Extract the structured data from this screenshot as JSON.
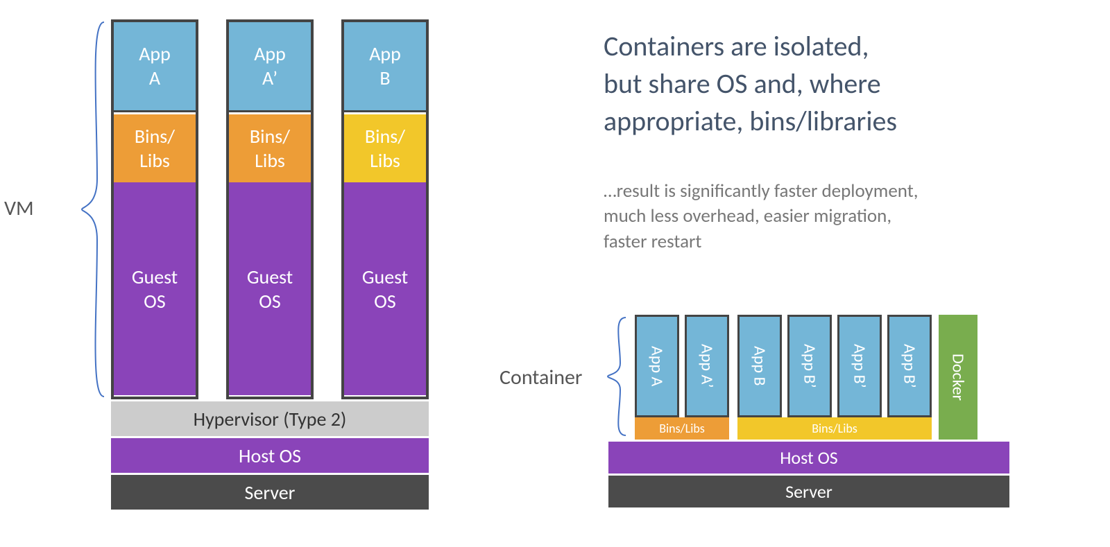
{
  "vm": {
    "label": "VM",
    "columns": [
      {
        "app": "App\nA",
        "lib": "Bins/\nLibs",
        "libColor": "orange",
        "os": "Guest\nOS"
      },
      {
        "app": "App\nA’",
        "lib": "Bins/\nLibs",
        "libColor": "orange",
        "os": "Guest\nOS"
      },
      {
        "app": "App\nB",
        "lib": "Bins/\nLibs",
        "libColor": "yellow",
        "os": "Guest\nOS"
      }
    ],
    "hypervisor": "Hypervisor (Type 2)",
    "host": "Host OS",
    "server": "Server"
  },
  "container": {
    "label": "Container",
    "apps": [
      "App A",
      "App A’",
      "App B",
      "App B’",
      "App B’",
      "App B’"
    ],
    "libs1": "Bins/Libs",
    "libs2": "Bins/Libs",
    "docker": "Docker",
    "host": "Host OS",
    "server": "Server"
  },
  "headline": "Containers are isolated,\nbut share OS and, where\nappropriate, bins/libraries",
  "sub": "…result is significantly faster deployment,\nmuch less overhead, easier migration,\nfaster restart"
}
